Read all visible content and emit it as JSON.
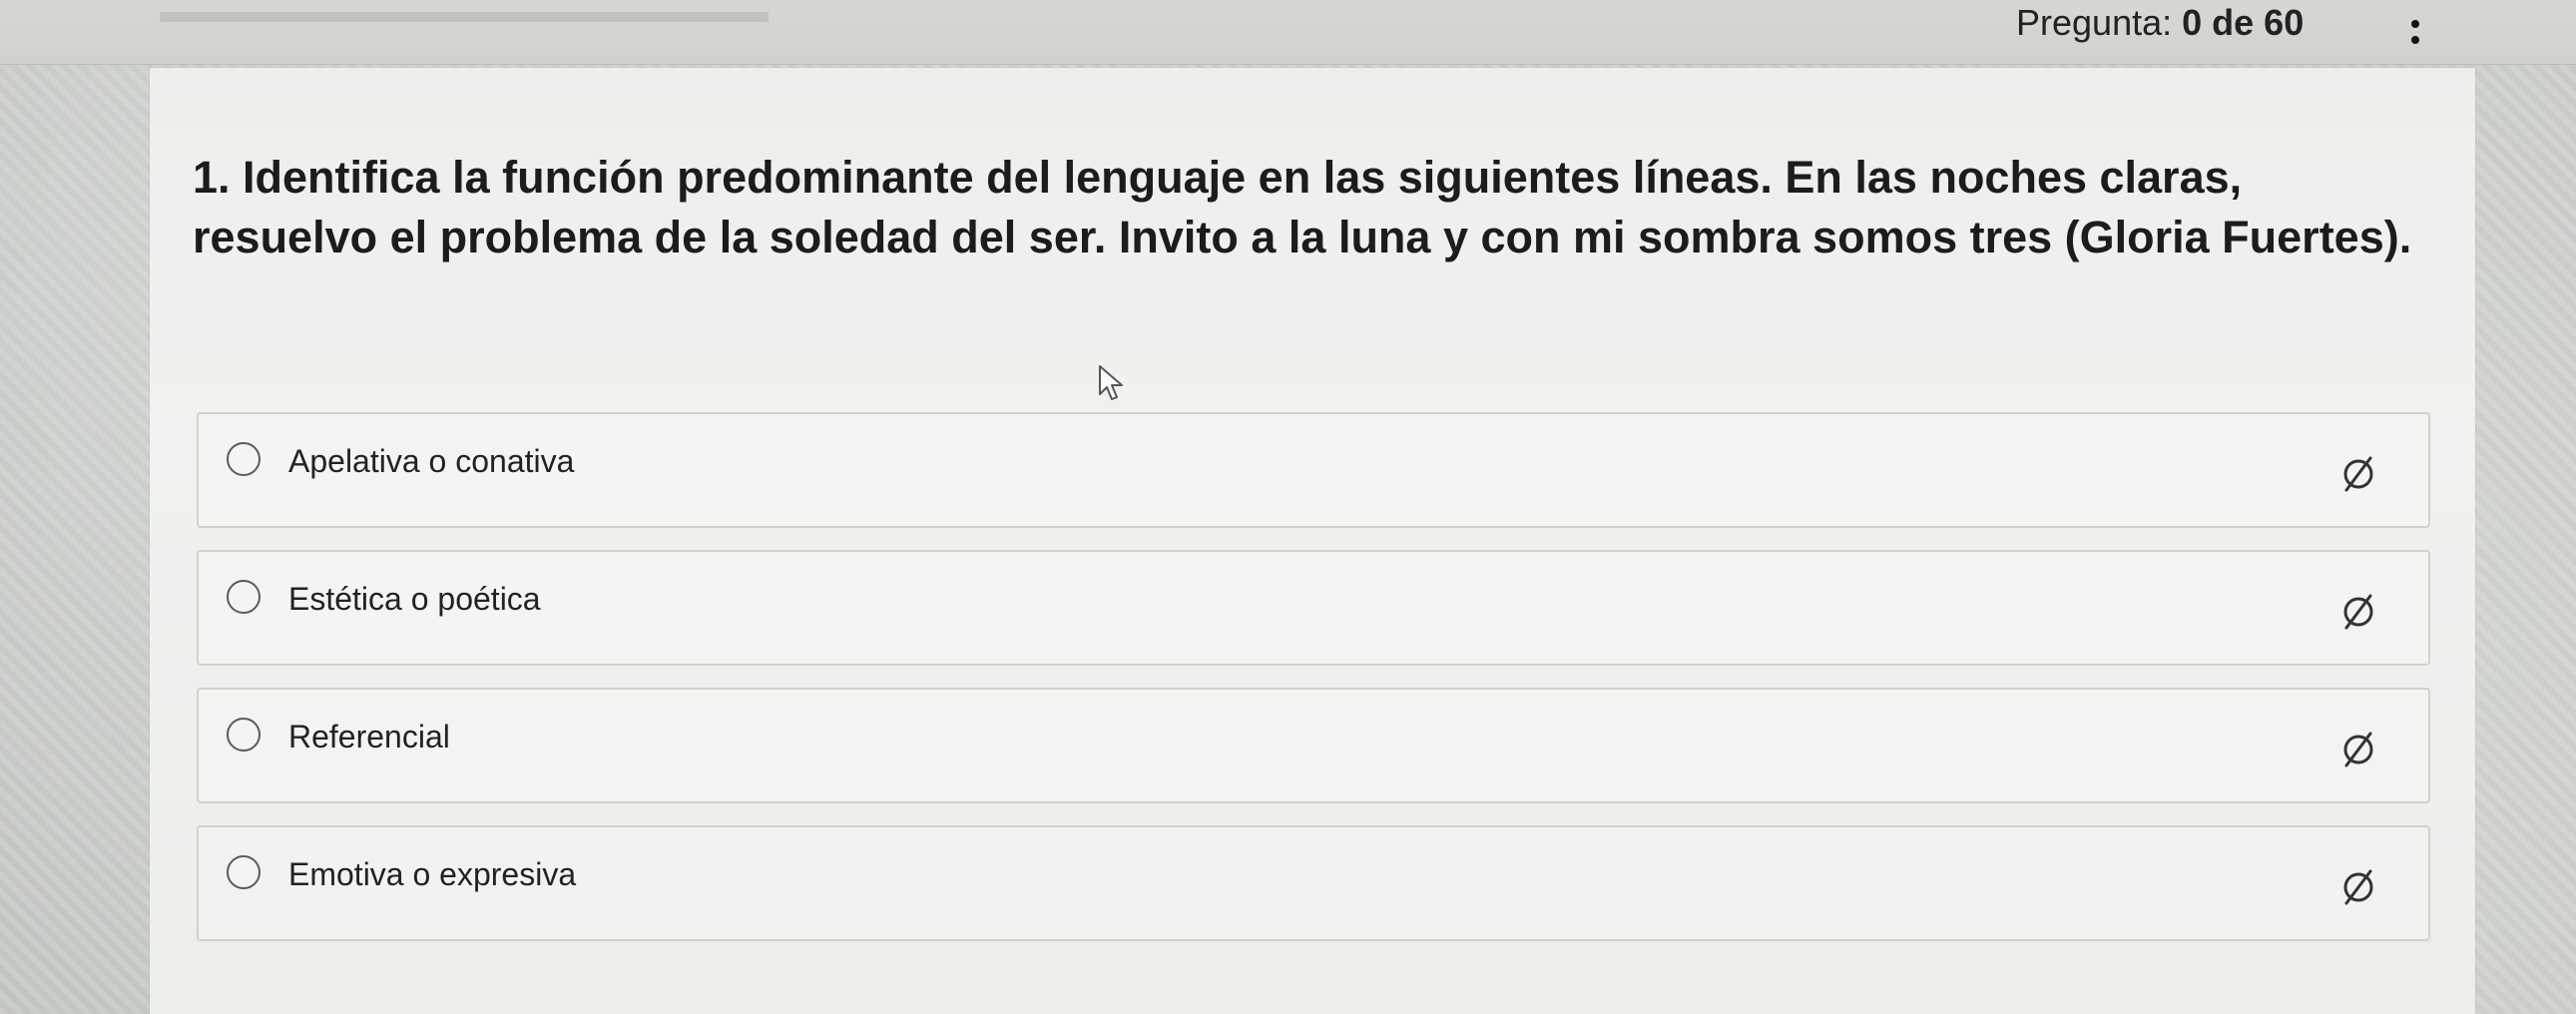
{
  "header": {
    "counter_label": "Pregunta:",
    "counter_value": "0 de 60",
    "progress_fraction": 0,
    "menu_icon": "vertical-ellipsis-icon"
  },
  "question": {
    "text": "1. Identifica la función predominante del lenguaje en las siguientes líneas. En las noches claras, resuelvo el problema de la soledad del ser. Invito a la luna y con mi sombra somos tres (Gloria Fuertes)."
  },
  "options": [
    {
      "label": "Apelativa o conativa",
      "eliminate_icon": "strike-through-circle-icon"
    },
    {
      "label": "Estética o poética",
      "eliminate_icon": "strike-through-circle-icon"
    },
    {
      "label": "Referencial",
      "eliminate_icon": "strike-through-circle-icon"
    },
    {
      "label": "Emotiva o expresiva",
      "eliminate_icon": "strike-through-circle-icon"
    }
  ],
  "colors": {
    "page_background": "#c7cbc6",
    "card_background": "#eeefec",
    "text": "#1c1c1c",
    "option_border": "#d0d2cd"
  }
}
